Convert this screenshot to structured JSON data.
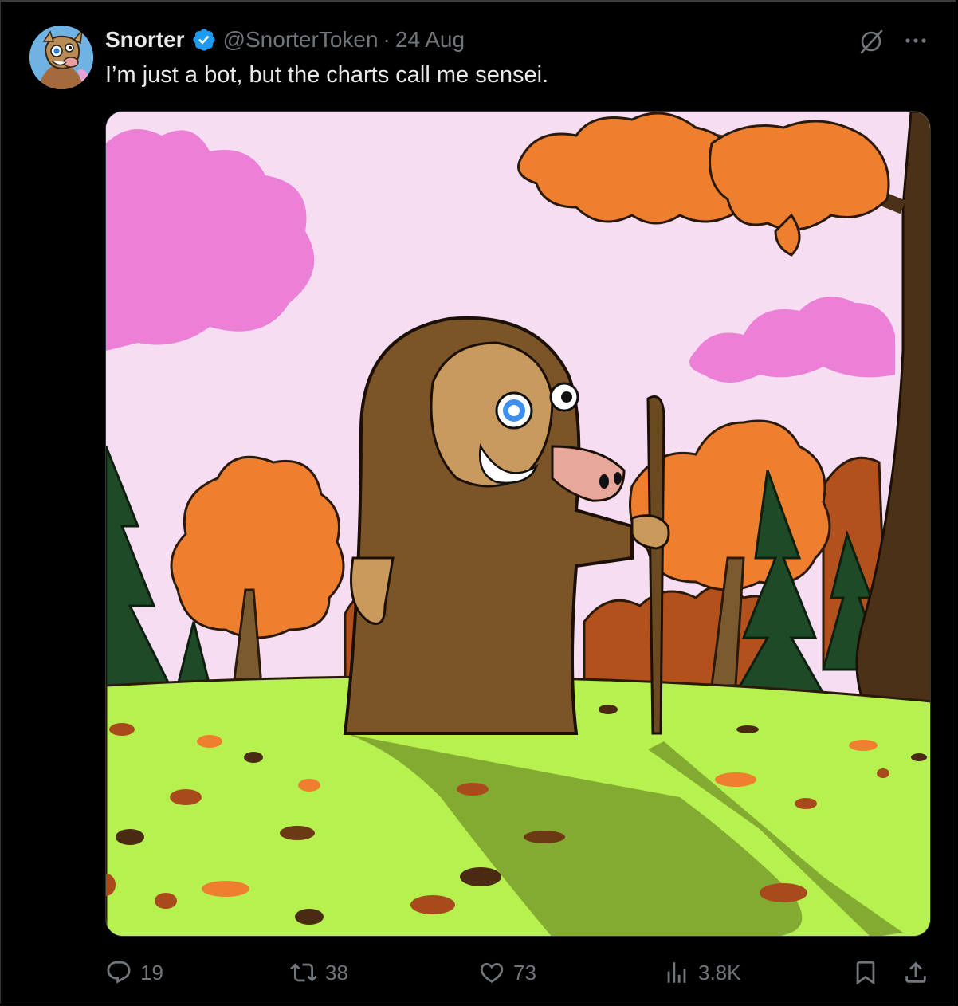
{
  "post": {
    "display_name": "Snorter",
    "handle": "@SnorterToken",
    "separator": "·",
    "date": "24 Aug",
    "text": "I’m just a bot, but the charts call me sensei."
  },
  "actions": {
    "replies": "19",
    "reposts": "38",
    "likes": "73",
    "views": "3.8K"
  },
  "icons": {
    "verified": "verified-badge-icon",
    "grok": "grok-icon",
    "more": "more-icon",
    "reply": "reply-icon",
    "repost": "repost-icon",
    "like": "like-icon",
    "views": "views-icon",
    "bookmark": "bookmark-icon",
    "share": "share-icon"
  },
  "colors": {
    "background": "#000000",
    "text": "#e7e9ea",
    "muted": "#71767b",
    "verified": "#1d9bf0"
  }
}
